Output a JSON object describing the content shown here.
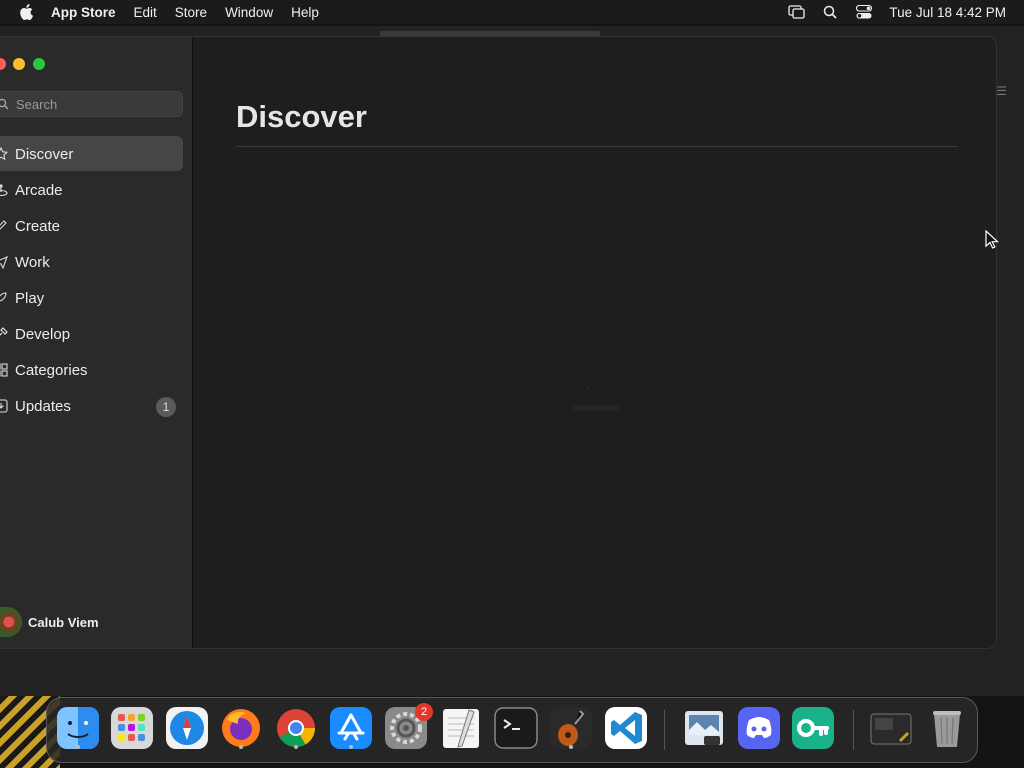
{
  "menubar": {
    "app_name": "App Store",
    "menus": [
      "Edit",
      "Store",
      "Window",
      "Help"
    ],
    "clock": "Tue Jul 18  4:42 PM"
  },
  "sidebar": {
    "search_placeholder": "Search",
    "items": [
      {
        "label": "Discover",
        "icon": "star-icon",
        "active": true
      },
      {
        "label": "Arcade",
        "icon": "joystick-icon"
      },
      {
        "label": "Create",
        "icon": "brush-icon"
      },
      {
        "label": "Work",
        "icon": "paperplane-icon"
      },
      {
        "label": "Play",
        "icon": "rocket-icon"
      },
      {
        "label": "Develop",
        "icon": "hammer-icon"
      },
      {
        "label": "Categories",
        "icon": "grid-icon"
      },
      {
        "label": "Updates",
        "icon": "download-icon",
        "badge": "1"
      }
    ],
    "user_name": "Calub Viem"
  },
  "main": {
    "title": "Discover"
  },
  "dock": {
    "items": [
      {
        "name": "finder",
        "color": "#2d8cf0",
        "running": true
      },
      {
        "name": "launchpad",
        "color": "#d8d8d8",
        "running": false
      },
      {
        "name": "safari",
        "color": "#1e88e5",
        "running": false
      },
      {
        "name": "firefox",
        "color": "#ff7a18",
        "running": true
      },
      {
        "name": "chrome",
        "color": "#ffffff",
        "running": true
      },
      {
        "name": "app-store",
        "color": "#1a8cff",
        "running": true
      },
      {
        "name": "system-settings",
        "color": "#8a8a8a",
        "running": false,
        "badge": "2"
      },
      {
        "name": "textedit",
        "color": "#f5f5f5",
        "running": false
      },
      {
        "name": "terminal",
        "color": "#1a1a1a",
        "running": false
      },
      {
        "name": "garageband",
        "color": "#c05a1a",
        "running": true
      },
      {
        "name": "vscode",
        "color": "#ffffff",
        "running": false
      },
      {
        "name": "preview",
        "color": "#5c84b0",
        "running": false
      },
      {
        "name": "discord",
        "color": "#5865f2",
        "running": false
      },
      {
        "name": "passwords",
        "color": "#19b28a",
        "running": false
      },
      {
        "name": "screenshot",
        "color": "#2a2a2a",
        "running": false
      },
      {
        "name": "trash",
        "color": "#8a8a8a",
        "running": false
      }
    ]
  }
}
